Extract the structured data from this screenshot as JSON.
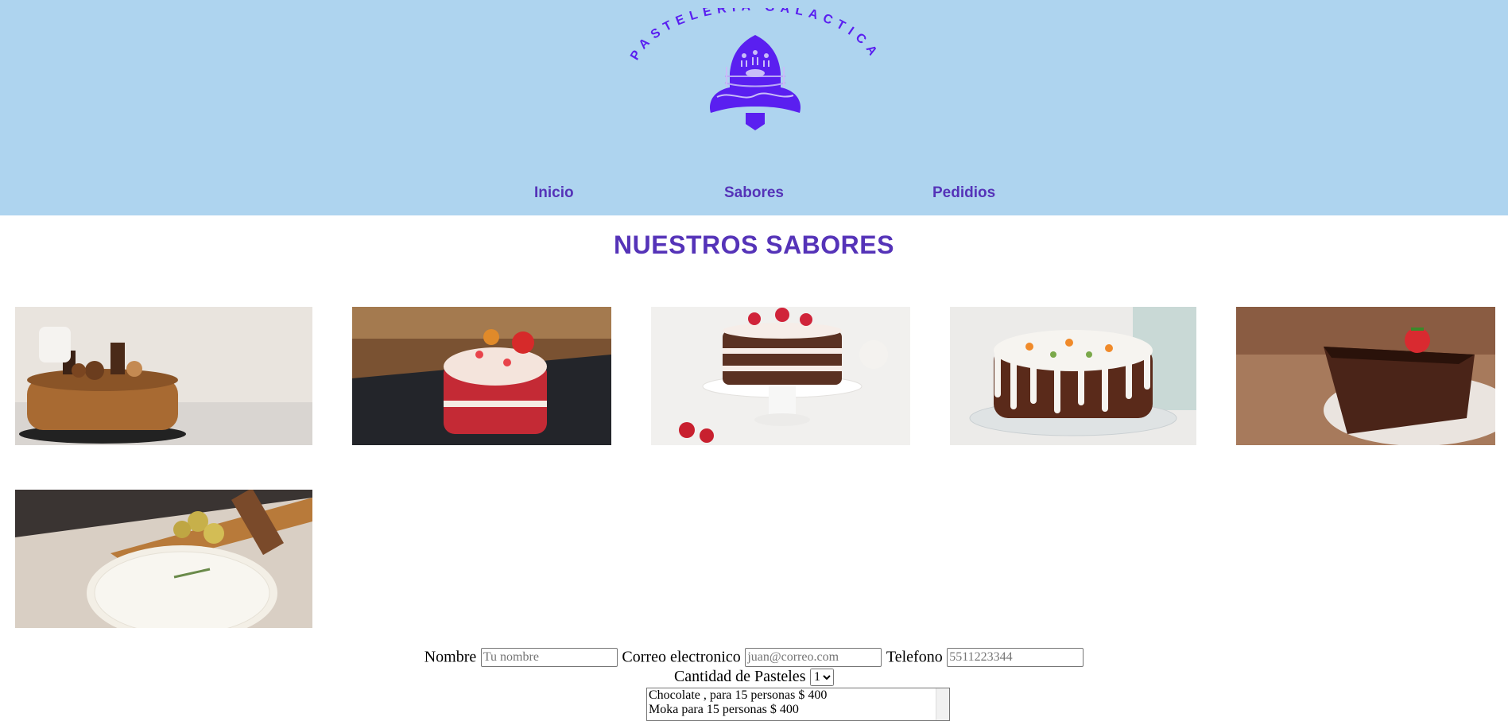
{
  "header": {
    "brand": "PASTELERÍA GALACTICA",
    "background_color": "#aed4ef",
    "accent_color": "#5533b8",
    "logo_color": "#5a1ff0",
    "nav": [
      {
        "label": "Inicio"
      },
      {
        "label": "Sabores"
      },
      {
        "label": "Pedidios"
      }
    ]
  },
  "main": {
    "section_title": "NUESTROS SABORES",
    "cakes": [
      {
        "icon": "chocolate-truffle-cake-image"
      },
      {
        "icon": "red-velvet-cake-image"
      },
      {
        "icon": "chocolate-strawberry-layer-cake-image"
      },
      {
        "icon": "carrot-cake-image"
      },
      {
        "icon": "chocolate-cake-slice-image"
      },
      {
        "icon": "cheesecake-brie-image"
      }
    ]
  },
  "form": {
    "name_label": "Nombre",
    "name_placeholder": "Tu nombre",
    "email_label": "Correo electronico",
    "email_placeholder": "juan@correo.com",
    "phone_label": "Telefono",
    "phone_placeholder": "5511223344",
    "quantity_label": "Cantidad de Pasteles",
    "quantity_value": "1",
    "flavor_options": [
      "Chocolate , para 15 personas $ 400",
      "Moka para 15 personas $ 400"
    ]
  }
}
